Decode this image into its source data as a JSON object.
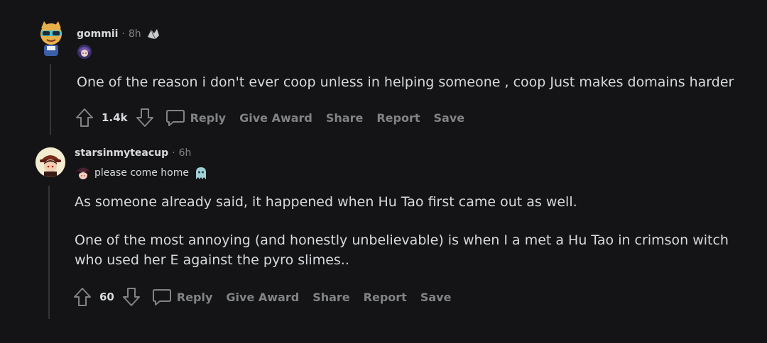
{
  "comments": [
    {
      "username": "gommii",
      "time": "8h",
      "award_icon": "broken-heart-award-icon",
      "flair_text": "",
      "flair_icon": "character-emoji-icon",
      "paragraphs": [
        "One of the reason i don't ever coop unless in helping someone , coop Just makes domains harder"
      ],
      "votes": "1.4k",
      "actions": {
        "reply": "Reply",
        "award": "Give Award",
        "share": "Share",
        "report": "Report",
        "save": "Save"
      }
    },
    {
      "username": "starsinmyteacup",
      "time": "6h",
      "flair_text": "please come home",
      "flair_icon": "character-emoji-icon",
      "flair_icon_2": "ghost-emoji-icon",
      "paragraphs": [
        "As someone already said, it happened when Hu Tao first came out as well.",
        "One of the most annoying (and honestly unbelievable) is when I a met a Hu Tao in crimson witch who used her E against the pyro slimes.."
      ],
      "votes": "60",
      "actions": {
        "reply": "Reply",
        "award": "Give Award",
        "share": "Share",
        "report": "Report",
        "save": "Save"
      }
    }
  ],
  "colors": {
    "background": "#141416",
    "text": "#d7dadc",
    "muted": "#818384",
    "thread_line": "#343536"
  }
}
